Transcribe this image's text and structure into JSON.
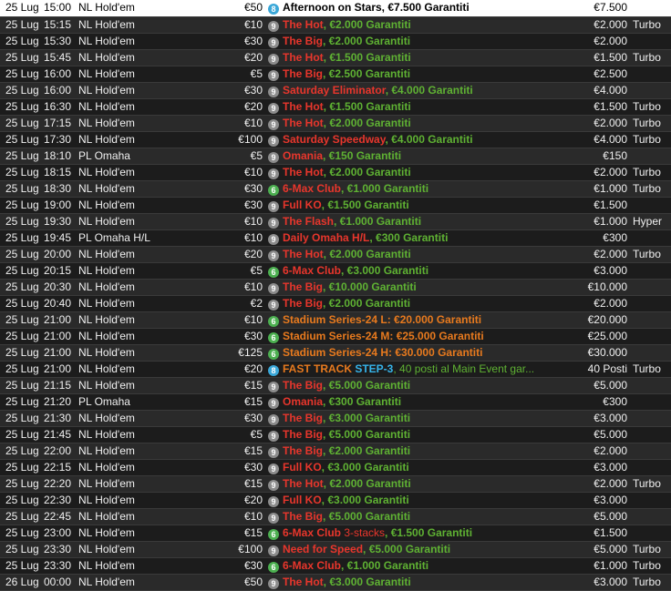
{
  "rows": [
    {
      "date": "25 Lug",
      "time": "15:00",
      "game": "NL Hold'em",
      "fee": "€50",
      "seats": "8",
      "seat_color": "b8",
      "name": "Afternoon on Stars",
      "name_color": "nm-blk",
      "desc": ", €7.500 Garantiti",
      "desc_color": "nm-blk",
      "prize": "€7.500",
      "speed": ""
    },
    {
      "date": "25 Lug",
      "time": "15:15",
      "game": "NL Hold'em",
      "fee": "€10",
      "seats": "9",
      "seat_color": "b9",
      "name": "The Hot",
      "name_color": "nm-red",
      "desc": ", €2.000 Garantiti",
      "desc_color": "desc-grn",
      "prize": "€2.000",
      "speed": "Turbo"
    },
    {
      "date": "25 Lug",
      "time": "15:30",
      "game": "NL Hold'em",
      "fee": "€30",
      "seats": "9",
      "seat_color": "b9",
      "name": "The Big",
      "name_color": "nm-red",
      "desc": ", €2.000 Garantiti",
      "desc_color": "desc-grn",
      "prize": "€2.000",
      "speed": ""
    },
    {
      "date": "25 Lug",
      "time": "15:45",
      "game": "NL Hold'em",
      "fee": "€20",
      "seats": "9",
      "seat_color": "b9",
      "name": "The Hot",
      "name_color": "nm-red",
      "desc": ", €1.500 Garantiti",
      "desc_color": "desc-grn",
      "prize": "€1.500",
      "speed": "Turbo"
    },
    {
      "date": "25 Lug",
      "time": "16:00",
      "game": "NL Hold'em",
      "fee": "€5",
      "seats": "9",
      "seat_color": "b9",
      "name": "The Big",
      "name_color": "nm-red",
      "desc": ", €2.500 Garantiti",
      "desc_color": "desc-grn",
      "prize": "€2.500",
      "speed": ""
    },
    {
      "date": "25 Lug",
      "time": "16:00",
      "game": "NL Hold'em",
      "fee": "€30",
      "seats": "9",
      "seat_color": "b9",
      "name": "Saturday Eliminator",
      "name_color": "nm-red",
      "desc": ", €4.000 Garantiti",
      "desc_color": "desc-grn",
      "prize": "€4.000",
      "speed": ""
    },
    {
      "date": "25 Lug",
      "time": "16:30",
      "game": "NL Hold'em",
      "fee": "€20",
      "seats": "9",
      "seat_color": "b9",
      "name": "The Hot",
      "name_color": "nm-red",
      "desc": ", €1.500 Garantiti",
      "desc_color": "desc-grn",
      "prize": "€1.500",
      "speed": "Turbo"
    },
    {
      "date": "25 Lug",
      "time": "17:15",
      "game": "NL Hold'em",
      "fee": "€10",
      "seats": "9",
      "seat_color": "b9",
      "name": "The Hot",
      "name_color": "nm-red",
      "desc": ", €2.000 Garantiti",
      "desc_color": "desc-grn",
      "prize": "€2.000",
      "speed": "Turbo"
    },
    {
      "date": "25 Lug",
      "time": "17:30",
      "game": "NL Hold'em",
      "fee": "€100",
      "seats": "9",
      "seat_color": "b9",
      "name": "Saturday Speedway",
      "name_color": "nm-red",
      "desc": ", €4.000 Garantiti",
      "desc_color": "desc-grn",
      "prize": "€4.000",
      "speed": "Turbo"
    },
    {
      "date": "25 Lug",
      "time": "18:10",
      "game": "PL Omaha",
      "fee": "€5",
      "seats": "9",
      "seat_color": "b9",
      "name": "Omania",
      "name_color": "nm-red",
      "desc": ", €150 Garantiti",
      "desc_color": "desc-grn",
      "prize": "€150",
      "speed": ""
    },
    {
      "date": "25 Lug",
      "time": "18:15",
      "game": "NL Hold'em",
      "fee": "€10",
      "seats": "9",
      "seat_color": "b9",
      "name": "The Hot",
      "name_color": "nm-red",
      "desc": ", €2.000 Garantiti",
      "desc_color": "desc-grn",
      "prize": "€2.000",
      "speed": "Turbo"
    },
    {
      "date": "25 Lug",
      "time": "18:30",
      "game": "NL Hold'em",
      "fee": "€30",
      "seats": "6",
      "seat_color": "b6",
      "name": "6-Max Club",
      "name_color": "nm-red",
      "desc": ", €1.000 Garantiti",
      "desc_color": "desc-grn",
      "prize": "€1.000",
      "speed": "Turbo"
    },
    {
      "date": "25 Lug",
      "time": "19:00",
      "game": "NL Hold'em",
      "fee": "€30",
      "seats": "9",
      "seat_color": "b9",
      "name": "Full KO",
      "name_color": "nm-red",
      "desc": ", €1.500 Garantiti",
      "desc_color": "desc-grn",
      "prize": "€1.500",
      "speed": ""
    },
    {
      "date": "25 Lug",
      "time": "19:30",
      "game": "NL Hold'em",
      "fee": "€10",
      "seats": "9",
      "seat_color": "b9",
      "name": "The Flash",
      "name_color": "nm-red",
      "desc": ", €1.000 Garantiti",
      "desc_color": "desc-grn",
      "prize": "€1.000",
      "speed": "Hyper"
    },
    {
      "date": "25 Lug",
      "time": "19:45",
      "game": "PL Omaha H/L",
      "fee": "€10",
      "seats": "9",
      "seat_color": "b9",
      "name": "Daily Omaha H/L",
      "name_color": "nm-red",
      "desc": ", €300 Garantiti",
      "desc_color": "desc-grn",
      "prize": "€300",
      "speed": ""
    },
    {
      "date": "25 Lug",
      "time": "20:00",
      "game": "NL Hold'em",
      "fee": "€20",
      "seats": "9",
      "seat_color": "b9",
      "name": "The Hot",
      "name_color": "nm-red",
      "desc": ", €2.000 Garantiti",
      "desc_color": "desc-grn",
      "prize": "€2.000",
      "speed": "Turbo"
    },
    {
      "date": "25 Lug",
      "time": "20:15",
      "game": "NL Hold'em",
      "fee": "€5",
      "seats": "6",
      "seat_color": "b6",
      "name": "6-Max Club",
      "name_color": "nm-red",
      "desc": ", €3.000 Garantiti",
      "desc_color": "desc-grn",
      "prize": "€3.000",
      "speed": ""
    },
    {
      "date": "25 Lug",
      "time": "20:30",
      "game": "NL Hold'em",
      "fee": "€10",
      "seats": "9",
      "seat_color": "b9",
      "name": "The Big",
      "name_color": "nm-red",
      "desc": ", €10.000 Garantiti",
      "desc_color": "desc-grn",
      "prize": "€10.000",
      "speed": ""
    },
    {
      "date": "25 Lug",
      "time": "20:40",
      "game": "NL Hold'em",
      "fee": "€2",
      "seats": "9",
      "seat_color": "b9",
      "name": "The Big",
      "name_color": "nm-red",
      "desc": ", €2.000 Garantiti",
      "desc_color": "desc-grn",
      "prize": "€2.000",
      "speed": ""
    },
    {
      "date": "25 Lug",
      "time": "21:00",
      "game": "NL Hold'em",
      "fee": "€10",
      "seats": "6",
      "seat_color": "b6",
      "name": "Stadium Series-24 L",
      "name_color": "nm-org",
      "desc": ": €20.000 Garantiti",
      "desc_color": "nm-org",
      "prize": "€20.000",
      "speed": ""
    },
    {
      "date": "25 Lug",
      "time": "21:00",
      "game": "NL Hold'em",
      "fee": "€30",
      "seats": "6",
      "seat_color": "b6",
      "name": "Stadium Series-24 M",
      "name_color": "nm-org",
      "desc": ": €25.000 Garantiti",
      "desc_color": "nm-org",
      "prize": "€25.000",
      "speed": ""
    },
    {
      "date": "25 Lug",
      "time": "21:00",
      "game": "NL Hold'em",
      "fee": "€125",
      "seats": "6",
      "seat_color": "b6",
      "name": "Stadium Series-24 H",
      "name_color": "nm-org",
      "desc": ": €30.000 Garantiti",
      "desc_color": "nm-org",
      "prize": "€30.000",
      "speed": ""
    },
    {
      "date": "25 Lug",
      "time": "21:00",
      "game": "NL Hold'em",
      "fee": "€20",
      "seats": "8",
      "seat_color": "b8",
      "name": "FAST TRACK",
      "name_color": "nm-org",
      "desc": " STEP-3",
      "desc_color": "nm-blu",
      "desc2": ", 40 posti al Main Event gar...",
      "prize": "40 Posti",
      "speed": "Turbo"
    },
    {
      "date": "25 Lug",
      "time": "21:15",
      "game": "NL Hold'em",
      "fee": "€15",
      "seats": "9",
      "seat_color": "b9",
      "name": "The Big",
      "name_color": "nm-red",
      "desc": ", €5.000 Garantiti",
      "desc_color": "desc-grn",
      "prize": "€5.000",
      "speed": ""
    },
    {
      "date": "25 Lug",
      "time": "21:20",
      "game": "PL Omaha",
      "fee": "€15",
      "seats": "9",
      "seat_color": "b9",
      "name": "Omania",
      "name_color": "nm-red",
      "desc": ", €300 Garantiti",
      "desc_color": "desc-grn",
      "prize": "€300",
      "speed": ""
    },
    {
      "date": "25 Lug",
      "time": "21:30",
      "game": "NL Hold'em",
      "fee": "€30",
      "seats": "9",
      "seat_color": "b9",
      "name": "The Big",
      "name_color": "nm-red",
      "desc": ", €3.000 Garantiti",
      "desc_color": "desc-grn",
      "prize": "€3.000",
      "speed": ""
    },
    {
      "date": "25 Lug",
      "time": "21:45",
      "game": "NL Hold'em",
      "fee": "€5",
      "seats": "9",
      "seat_color": "b9",
      "name": "The Big",
      "name_color": "nm-red",
      "desc": ", €5.000 Garantiti",
      "desc_color": "desc-grn",
      "prize": "€5.000",
      "speed": ""
    },
    {
      "date": "25 Lug",
      "time": "22:00",
      "game": "NL Hold'em",
      "fee": "€15",
      "seats": "9",
      "seat_color": "b9",
      "name": "The Big",
      "name_color": "nm-red",
      "desc": ", €2.000 Garantiti",
      "desc_color": "desc-grn",
      "prize": "€2.000",
      "speed": ""
    },
    {
      "date": "25 Lug",
      "time": "22:15",
      "game": "NL Hold'em",
      "fee": "€30",
      "seats": "9",
      "seat_color": "b9",
      "name": "Full KO",
      "name_color": "nm-red",
      "desc": ", €3.000 Garantiti",
      "desc_color": "desc-grn",
      "prize": "€3.000",
      "speed": ""
    },
    {
      "date": "25 Lug",
      "time": "22:20",
      "game": "NL Hold'em",
      "fee": "€15",
      "seats": "9",
      "seat_color": "b9",
      "name": "The Hot",
      "name_color": "nm-red",
      "desc": ", €2.000 Garantiti",
      "desc_color": "desc-grn",
      "prize": "€2.000",
      "speed": "Turbo"
    },
    {
      "date": "25 Lug",
      "time": "22:30",
      "game": "NL Hold'em",
      "fee": "€20",
      "seats": "9",
      "seat_color": "b9",
      "name": "Full KO",
      "name_color": "nm-red",
      "desc": ", €3.000 Garantiti",
      "desc_color": "desc-grn",
      "prize": "€3.000",
      "speed": ""
    },
    {
      "date": "25 Lug",
      "time": "22:45",
      "game": "NL Hold'em",
      "fee": "€10",
      "seats": "9",
      "seat_color": "b9",
      "name": "The Big",
      "name_color": "nm-red",
      "desc": ", €5.000 Garantiti",
      "desc_color": "desc-grn",
      "prize": "€5.000",
      "speed": ""
    },
    {
      "date": "25 Lug",
      "time": "23:00",
      "game": "NL Hold'em",
      "fee": "€15",
      "seats": "6",
      "seat_color": "b6",
      "name": "6-Max Club",
      "name_color": "nm-red",
      "desc": " 3-stacks",
      "desc_color": "desc-red",
      "desc2": ", €1.500 Garantiti",
      "prize": "€1.500",
      "speed": ""
    },
    {
      "date": "25 Lug",
      "time": "23:30",
      "game": "NL Hold'em",
      "fee": "€100",
      "seats": "9",
      "seat_color": "b9",
      "name": "Need for Speed",
      "name_color": "nm-red",
      "desc": ", €5.000 Garantiti",
      "desc_color": "desc-grn",
      "prize": "€5.000",
      "speed": "Turbo"
    },
    {
      "date": "25 Lug",
      "time": "23:30",
      "game": "NL Hold'em",
      "fee": "€30",
      "seats": "6",
      "seat_color": "b6",
      "name": "6-Max Club",
      "name_color": "nm-red",
      "desc": ", €1.000 Garantiti",
      "desc_color": "desc-grn",
      "prize": "€1.000",
      "speed": "Turbo"
    },
    {
      "date": "26 Lug",
      "time": "00:00",
      "game": "NL Hold'em",
      "fee": "€50",
      "seats": "9",
      "seat_color": "b9",
      "name": "The Hot",
      "name_color": "nm-red",
      "desc": ", €3.000 Garantiti",
      "desc_color": "desc-grn",
      "prize": "€3.000",
      "speed": "Turbo"
    }
  ]
}
